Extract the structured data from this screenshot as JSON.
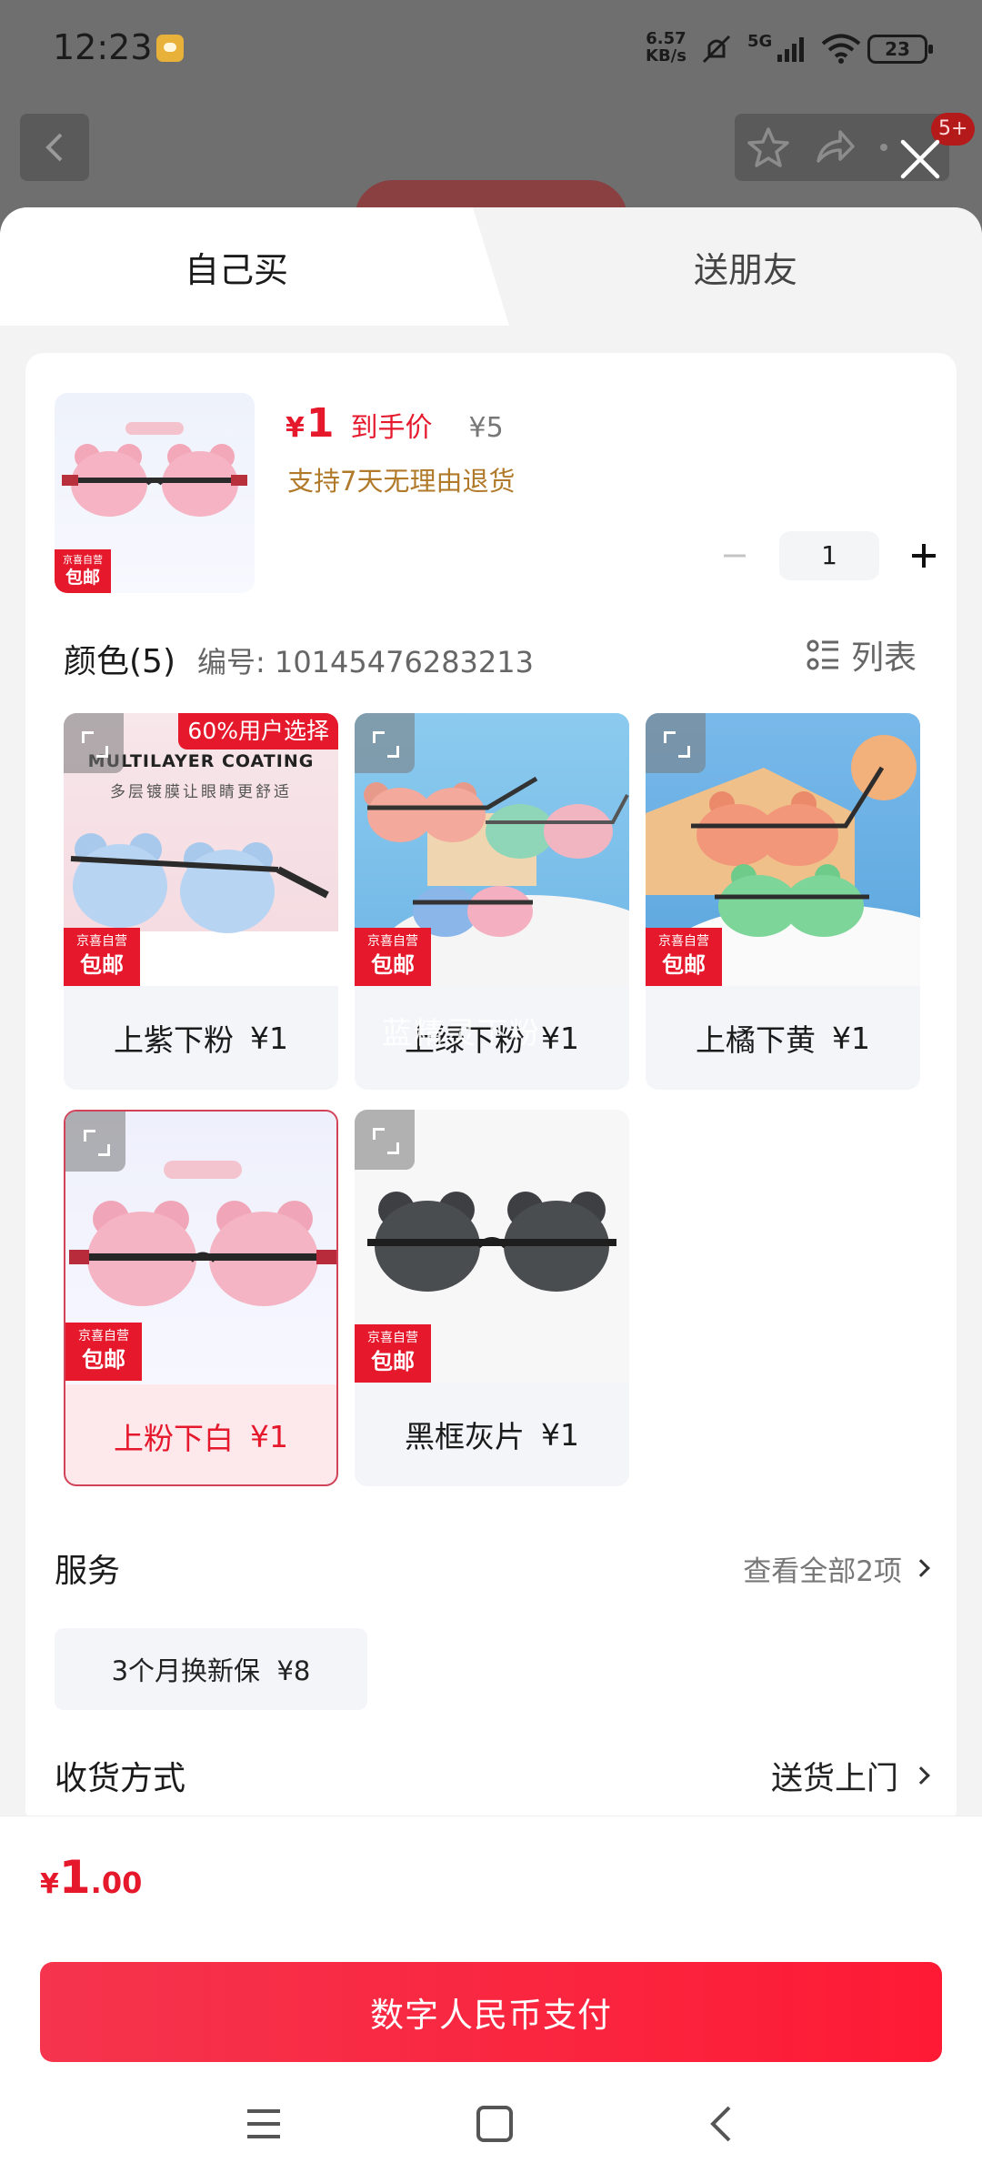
{
  "status_bar": {
    "time": "12:23",
    "net_speed_value": "6.57",
    "net_speed_unit": "KB/s",
    "network": "5G",
    "battery": "23"
  },
  "background": {
    "badge": "5+"
  },
  "tabs": {
    "buy_self": "自己买",
    "gift": "送朋友"
  },
  "product": {
    "currency": "¥",
    "price": "1",
    "price_label": "到手价",
    "original_price": "¥5",
    "return_policy": "支持7天无理由退货",
    "quantity": "1",
    "thumb_badge_top": "京喜自营",
    "thumb_badge_bottom": "包邮"
  },
  "color_section": {
    "title": "颜色(5)",
    "code": "编号: 10145476283213",
    "list_label": "列表"
  },
  "variants": [
    {
      "name": "上紫下粉",
      "price": "¥1",
      "popular": "60%用户选择",
      "headline": "MULTILAYER COATING",
      "subline": "多层镀膜让眼睛更舒适",
      "badge_top": "京喜自营",
      "badge_bottom": "包邮",
      "selected": false
    },
    {
      "name": "上绿下粉",
      "price": "¥1",
      "overlay": "蓝精灵下粉",
      "badge_top": "京喜自营",
      "badge_bottom": "包邮",
      "selected": false
    },
    {
      "name": "上橘下黄",
      "price": "¥1",
      "badge_top": "京喜自营",
      "badge_bottom": "包邮",
      "selected": false
    },
    {
      "name": "上粉下白",
      "price": "¥1",
      "badge_top": "京喜自营",
      "badge_bottom": "包邮",
      "selected": true
    },
    {
      "name": "黑框灰片",
      "price": "¥1",
      "badge_top": "京喜自营",
      "badge_bottom": "包邮",
      "selected": false
    }
  ],
  "service": {
    "title": "服务",
    "more": "查看全部2项",
    "chip": "3个月换新保  ¥8"
  },
  "shipping": {
    "title": "收货方式",
    "value": "送货上门"
  },
  "total": {
    "currency": "¥",
    "integer": "1",
    "decimal": ".00"
  },
  "pay_button": "数字人民币支付",
  "colors": {
    "accent_red": "#e5182c",
    "return_text": "#b07a2a",
    "selected_bg": "#fde8ec"
  },
  "icons": [
    "back-icon",
    "star-icon",
    "share-icon",
    "more-icon",
    "close-icon",
    "expand-icon",
    "list-icon",
    "chevron-right-icon",
    "menu-icon",
    "home-icon",
    "nav-back-icon"
  ]
}
